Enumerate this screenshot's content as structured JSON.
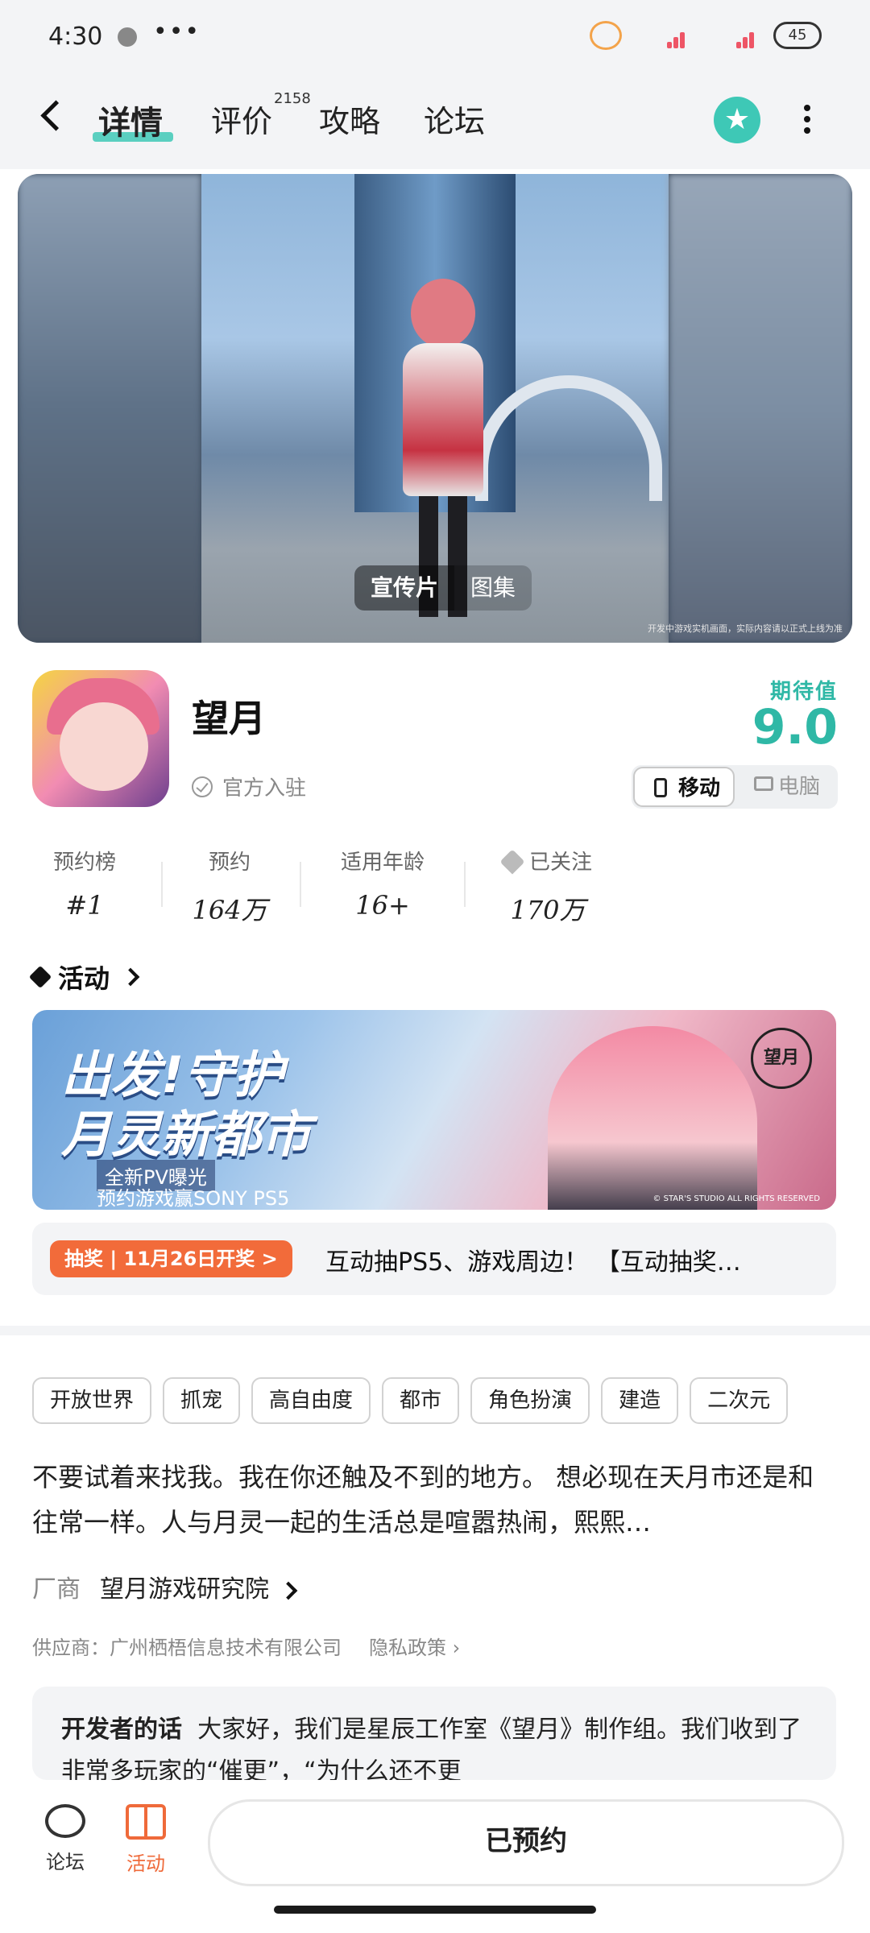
{
  "status": {
    "time": "4:30",
    "more": "•••",
    "battery": "45"
  },
  "nav": {
    "tabs": [
      {
        "label": "详情"
      },
      {
        "label": "评价"
      },
      {
        "label": "攻略"
      },
      {
        "label": "论坛"
      }
    ],
    "review_count": "2158",
    "star_icon": "★"
  },
  "hero": {
    "tabs": [
      "宣传片",
      "图集"
    ],
    "note": "开发中游戏实机画面，实际内容请以正式上线为准"
  },
  "game": {
    "title": "望月",
    "verified": "官方入驻",
    "expect_label": "期待值",
    "expect_score": "9.0",
    "platforms": [
      "移动",
      "电脑"
    ]
  },
  "stats": [
    {
      "label": "预约榜",
      "value": "#1"
    },
    {
      "label": "预约",
      "value": "164万"
    },
    {
      "label": "适用年龄",
      "value": "16+"
    },
    {
      "label": "已关注",
      "value": "170万"
    }
  ],
  "activity": {
    "header": "活动",
    "banner_line1": "出发!守护",
    "banner_line2": "月灵新都市",
    "banner_sub1": "全新PV曝光",
    "banner_sub2": "预约游戏赢SONY PS5",
    "banner_logo": "望月",
    "banner_copy": "© STAR'S STUDIO ALL RIGHTS RESERVED",
    "lottery_tag": "抽奖 | 11月26日开奖 >",
    "lottery_text": "互动抽PS5、游戏周边！ 【互动抽奖…"
  },
  "tags": [
    "开放世界",
    "抓宠",
    "高自由度",
    "都市",
    "角色扮演",
    "建造",
    "二次元"
  ],
  "description": "不要试着来找我。我在你还触及不到的地方。 想必现在天月市还是和往常一样。人与月灵一起的生活总是喧嚣热闹，熙熙…",
  "vendor": {
    "label": "厂商",
    "name": "望月游戏研究院"
  },
  "supplier": {
    "text": "供应商：广州栖梧信息技术有限公司",
    "privacy": "隐私政策"
  },
  "developer_note": {
    "label": "开发者的话",
    "text": "大家好，我们是星辰工作室《望月》制作组。我们收到了非常多玩家的“催更”，“为什么还不更"
  },
  "bottom": {
    "forum": "论坛",
    "activity": "活动",
    "reserved": "已预约"
  },
  "colors": {
    "accent": "#3ec8b6",
    "orange": "#ef6a3a"
  }
}
